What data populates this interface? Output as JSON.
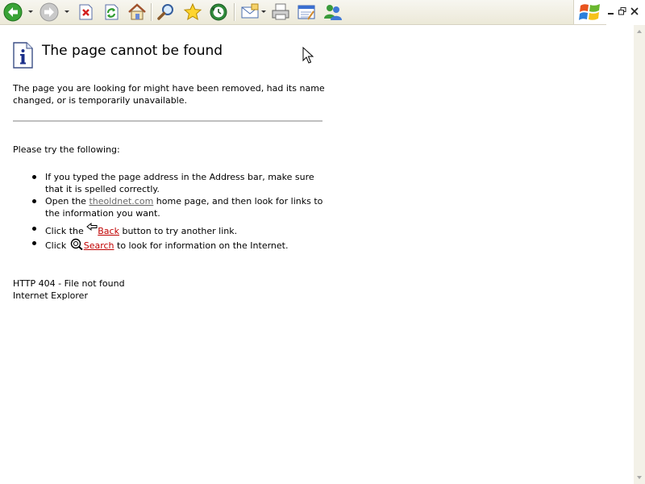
{
  "toolbar": {
    "buttons": [
      {
        "name": "back",
        "icon": "back-arrow-icon"
      },
      {
        "name": "forward",
        "icon": "forward-arrow-icon"
      },
      {
        "name": "stop",
        "icon": "stop-icon"
      },
      {
        "name": "refresh",
        "icon": "refresh-icon"
      },
      {
        "name": "home",
        "icon": "home-icon"
      },
      {
        "name": "search",
        "icon": "search-icon"
      },
      {
        "name": "favorites",
        "icon": "favorites-star-icon"
      },
      {
        "name": "history",
        "icon": "history-icon"
      },
      {
        "name": "mail",
        "icon": "mail-icon"
      },
      {
        "name": "print",
        "icon": "print-icon"
      },
      {
        "name": "edit",
        "icon": "edit-icon"
      },
      {
        "name": "messenger",
        "icon": "messenger-icon"
      }
    ]
  },
  "page": {
    "title": "The page cannot be found",
    "intro": "The page you are looking for might have been removed, had its name changed, or is temporarily unavailable.",
    "try_heading": "Please try the following:",
    "item1": "If you typed the page address in the Address bar, make sure that it is spelled correctly.",
    "item2_before": "Open the ",
    "item2_link": "theoldnet.com",
    "item2_after": " home page, and then look for links to the information you want.",
    "item3_before": "Click the ",
    "item3_link": "Back",
    "item3_after": " button to try another link.",
    "item4_before": "Click ",
    "item4_link": "Search",
    "item4_after": " to look for information on the Internet.",
    "error_code": "HTTP 404 - File not found",
    "error_source": "Internet Explorer"
  },
  "colors": {
    "link_red": "#c00000",
    "link_gray": "#666666",
    "divider": "#c0c0c0",
    "toolbar_bg": "#ece9d8"
  }
}
